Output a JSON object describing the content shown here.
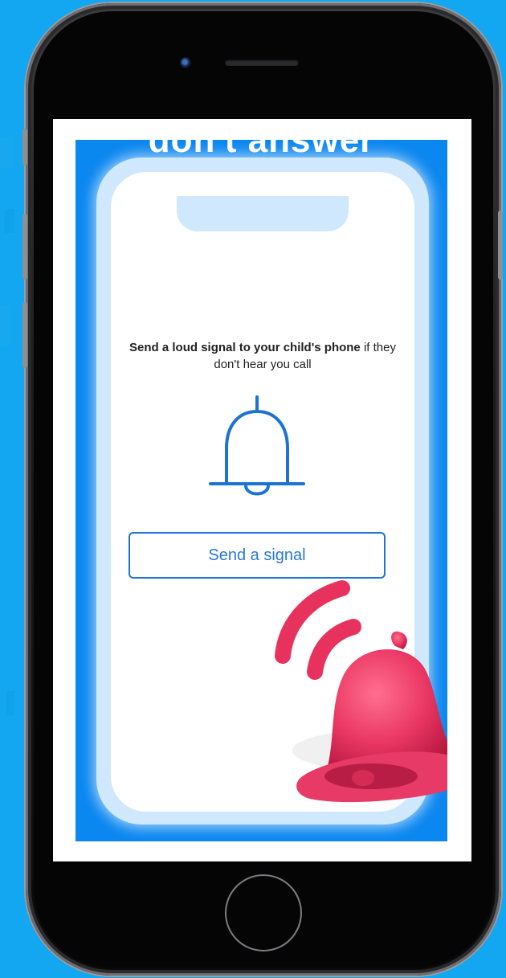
{
  "headline": "don't answer",
  "message": {
    "bold_part": "Send a loud signal to your child's phone",
    "regular_part": " if they don't hear you call"
  },
  "signal_button": {
    "label": "Send a signal"
  },
  "icons": {
    "outline_bell": "bell-icon",
    "pink_bell": "ringing-bell-icon",
    "home": "home-button",
    "camera": "front-camera",
    "speaker": "speaker-grille"
  },
  "colors": {
    "background": "#12a7f0",
    "media_blue": "#0b87f0",
    "accent_blue": "#1f74d6",
    "bell_pink": "#e8315f"
  }
}
